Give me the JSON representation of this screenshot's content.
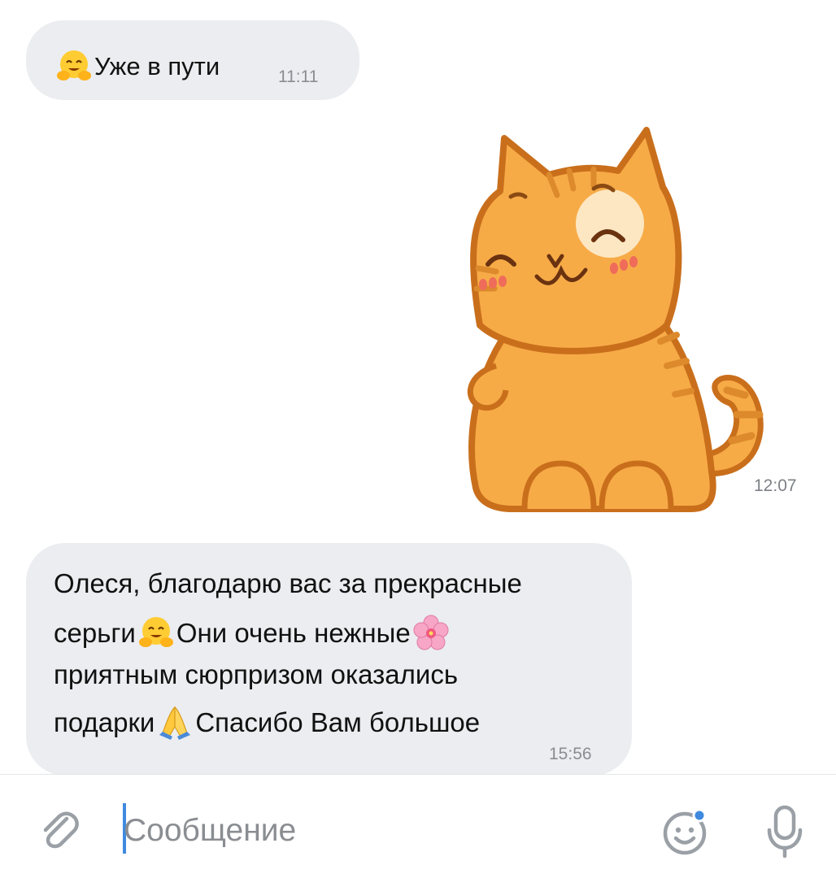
{
  "messages": [
    {
      "id": "m1",
      "direction": "incoming",
      "emoji": "hugging-face",
      "text": "Уже в пути",
      "time": "11:11"
    },
    {
      "id": "m2",
      "direction": "outgoing",
      "type": "sticker",
      "sticker": "ginger-cat-smiling",
      "time": "12:07"
    },
    {
      "id": "m3",
      "direction": "incoming",
      "lines": [
        {
          "text": "Олеся, благодарю вас за прекрасные"
        },
        {
          "text": "серьги",
          "emoji_after": "hugging-face",
          "text2": "Они очень нежные",
          "emoji_end": "cherry-blossom"
        },
        {
          "text": "приятным сюрпризом оказались"
        },
        {
          "text": "подарки",
          "emoji_after": "folded-hands",
          "text2": "Спасибо Вам большое"
        }
      ],
      "time": "15:56"
    }
  ],
  "composer": {
    "placeholder": "Сообщение",
    "value": "",
    "icons": {
      "attach": "paperclip-icon",
      "emoji": "emoji-smile-icon",
      "voice": "microphone-icon"
    },
    "accent": "#3f8ae0"
  },
  "colors": {
    "bubble": "#ebedf0",
    "time": "#8a8d91",
    "background": "#ffffff"
  }
}
